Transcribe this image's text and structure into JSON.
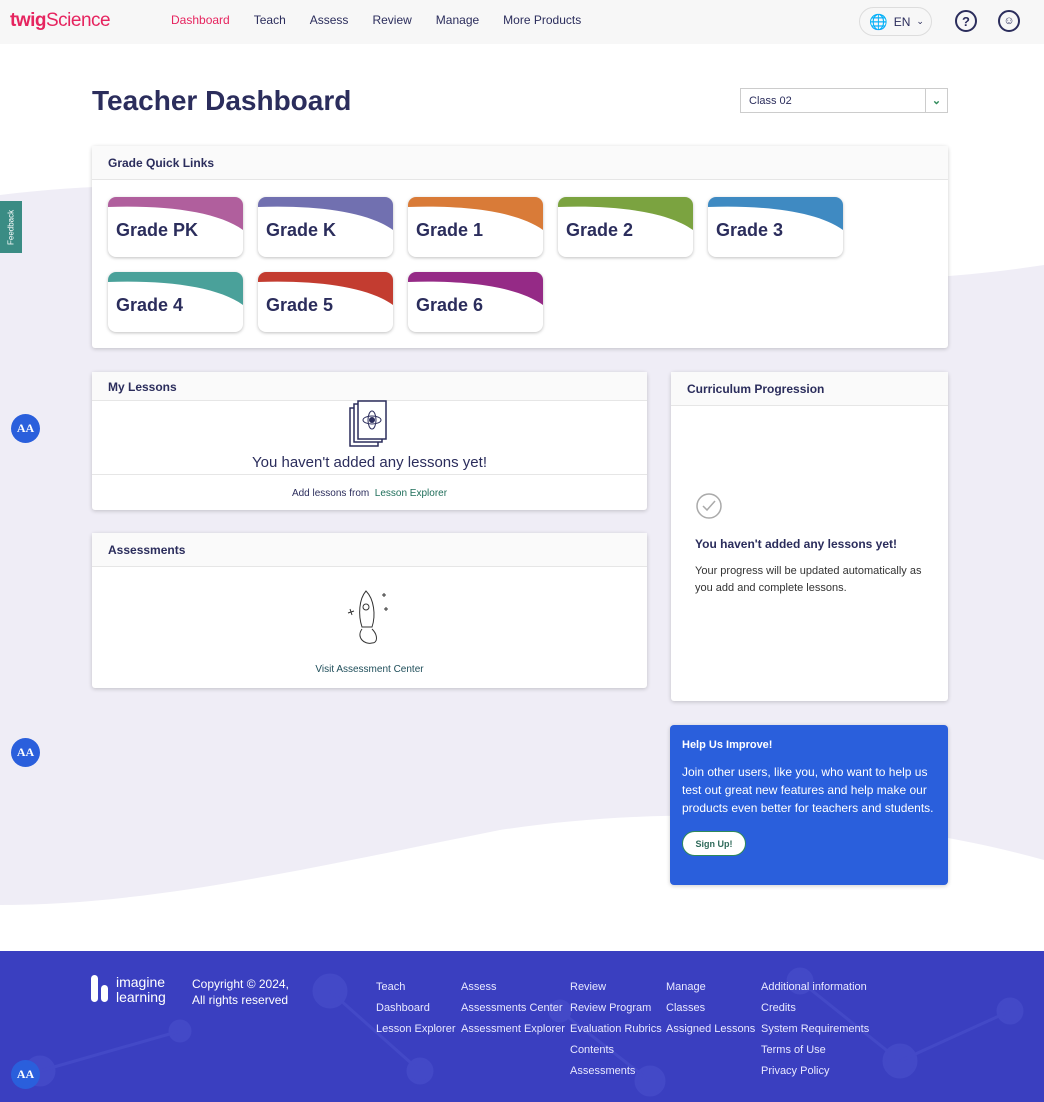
{
  "nav": {
    "logo_twig": "twig",
    "logo_science": "Science",
    "items": [
      {
        "label": "Dashboard",
        "active": true
      },
      {
        "label": "Teach"
      },
      {
        "label": "Assess"
      },
      {
        "label": "Review"
      },
      {
        "label": "Manage"
      },
      {
        "label": "More Products"
      }
    ],
    "language": "EN",
    "help_icon": "question-icon",
    "profile_icon": "user-icon"
  },
  "page": {
    "title": "Teacher Dashboard",
    "class_select": "Class 02",
    "feedback": "Feedback",
    "aa": "AA"
  },
  "grade_links": {
    "title": "Grade Quick Links",
    "grades": [
      {
        "label": "Grade PK",
        "color": "#b05f9d"
      },
      {
        "label": "Grade K",
        "color": "#7170b0"
      },
      {
        "label": "Grade 1",
        "color": "#d97b38"
      },
      {
        "label": "Grade 2",
        "color": "#7ba340"
      },
      {
        "label": "Grade 3",
        "color": "#3f8ac2"
      },
      {
        "label": "Grade 4",
        "color": "#4aa19a"
      },
      {
        "label": "Grade 5",
        "color": "#c33c30"
      },
      {
        "label": "Grade 6",
        "color": "#952a86"
      }
    ]
  },
  "my_lessons": {
    "title": "My Lessons",
    "empty": "You haven't added any lessons yet!",
    "add_from": "Add lessons from",
    "link": "Lesson Explorer"
  },
  "assessments": {
    "title": "Assessments",
    "link": "Visit Assessment Center"
  },
  "curriculum": {
    "title": "Curriculum Progression",
    "empty": "You haven't added any lessons yet!",
    "desc": "Your progress will be updated automatically as you add and complete lessons."
  },
  "help": {
    "title": "Help Us Improve!",
    "text": "Join other users, like you, who want to help us test out great new features and help make our products even better for teachers and students.",
    "button": "Sign Up!"
  },
  "footer": {
    "brand1": "imagine",
    "brand2": "learning",
    "copyright1": "Copyright © 2024,",
    "copyright2": "All rights reserved",
    "columns": [
      [
        "Teach",
        "Dashboard",
        "Lesson Explorer"
      ],
      [
        "Assess",
        "Assessments Center",
        "Assessment Explorer"
      ],
      [
        "Review",
        "Review Program",
        "Evaluation Rubrics",
        "Contents",
        "Assessments"
      ],
      [
        "Manage",
        "Classes",
        "Assigned Lessons"
      ],
      [
        "Additional information",
        "Credits",
        "System Requirements",
        "Terms of Use",
        "Privacy Policy"
      ]
    ]
  }
}
